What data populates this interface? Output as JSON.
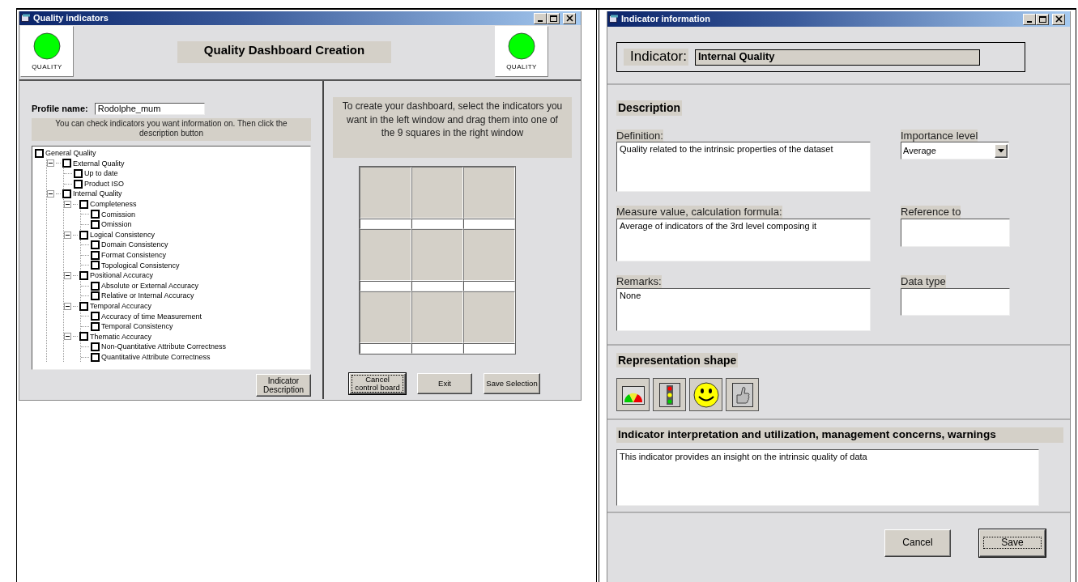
{
  "left_window": {
    "title": "Quality indicators",
    "heading": "Quality Dashboard Creation",
    "logos": [
      {
        "caption": "QUALITY"
      },
      {
        "caption": "QUALITY"
      }
    ],
    "profile": {
      "label": "Profile name:",
      "value": "Rodolphe_mum"
    },
    "tree_hint": "You can check indicators you want information on.  Then click  the description button",
    "tree": [
      {
        "label": "General Quality",
        "checked": false,
        "children": [
          {
            "label": "External Quality",
            "checked": false,
            "expanded": true,
            "children": [
              {
                "label": "Up to date",
                "checked": false
              },
              {
                "label": "Product ISO",
                "checked": false
              }
            ]
          },
          {
            "label": "Internal Quality",
            "checked": false,
            "expanded": true,
            "children": [
              {
                "label": "Completeness",
                "checked": false,
                "expanded": true,
                "children": [
                  {
                    "label": "Comission",
                    "checked": false
                  },
                  {
                    "label": "Omission",
                    "checked": false
                  }
                ]
              },
              {
                "label": "Logical Consistency",
                "checked": false,
                "expanded": true,
                "children": [
                  {
                    "label": "Domain Consistency",
                    "checked": false
                  },
                  {
                    "label": "Format Consistency",
                    "checked": false
                  },
                  {
                    "label": "Topological Consistency",
                    "checked": false
                  }
                ]
              },
              {
                "label": "Positional Accuracy",
                "checked": false,
                "expanded": true,
                "children": [
                  {
                    "label": "Absolute or External Accuracy",
                    "checked": false
                  },
                  {
                    "label": "Relative or Internal Accuracy",
                    "checked": false
                  }
                ]
              },
              {
                "label": "Temporal Accuracy",
                "checked": false,
                "expanded": true,
                "children": [
                  {
                    "label": "Accuracy of time Measurement",
                    "checked": false
                  },
                  {
                    "label": "Temporal Consistency",
                    "checked": false
                  }
                ]
              },
              {
                "label": "Thematic Accuracy",
                "checked": false,
                "expanded": true,
                "children": [
                  {
                    "label": "Non-Quantitative Attribute Correctness",
                    "checked": false
                  },
                  {
                    "label": "Quantitative Attribute Correctness",
                    "checked": false
                  }
                ]
              }
            ]
          }
        ]
      }
    ],
    "description_button": {
      "label": "Indicator Description",
      "focused": false
    },
    "dashboard_hint": "To create your dashboard, select the indicators you want in the left window and drag them into one of the 9 squares in the right window",
    "buttons": [
      {
        "label": "Cancel control board",
        "focused": true
      },
      {
        "label": "Exit",
        "focused": false
      },
      {
        "label": "Save Selection",
        "focused": false
      }
    ]
  },
  "right_window": {
    "title": "Indicator information",
    "indicator": {
      "label": "Indicator:",
      "value": "Internal Quality"
    },
    "description_heading": "Description",
    "definition": {
      "label": "Definition:",
      "value": "Quality related to the intrinsic properties of the dataset"
    },
    "importance": {
      "label": "Importance level",
      "value": "Average"
    },
    "measure": {
      "label": "Measure value, calculation formula:",
      "value": "Average of indicators of the 3rd level composing it"
    },
    "reference": {
      "label": "Reference to"
    },
    "remarks": {
      "label": "Remarks:",
      "value": "None"
    },
    "data_type": {
      "label": "Data type"
    },
    "shape_heading": "Representation shape",
    "shapes": [
      {
        "kind": "gauge"
      },
      {
        "kind": "traffic"
      },
      {
        "kind": "smiley"
      },
      {
        "kind": "thumb"
      }
    ],
    "interpretation": {
      "label": "Indicator interpretation and utilization, management concerns, warnings",
      "value": "This indicator provides an insight on the intrinsic quality of data"
    },
    "buttons": [
      {
        "label": "Cancel",
        "focused": false
      },
      {
        "label": "Save",
        "focused": true
      }
    ]
  }
}
